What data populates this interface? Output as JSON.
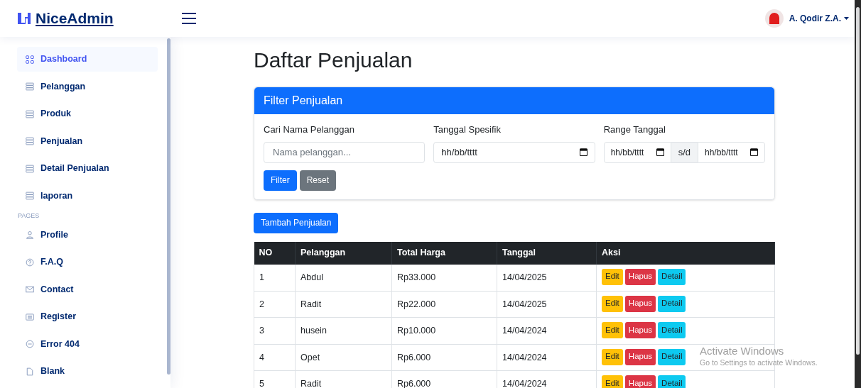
{
  "header": {
    "logo": "NiceAdmin",
    "user": "A. Qodir Z.A."
  },
  "sidebar": {
    "items": [
      {
        "label": "Dashboard",
        "selected": true
      },
      {
        "label": "Pelanggan",
        "selected": false
      },
      {
        "label": "Produk",
        "selected": false
      },
      {
        "label": "Penjualan",
        "selected": false
      },
      {
        "label": "Detail Penjualan",
        "selected": false
      },
      {
        "label": "laporan",
        "selected": false
      },
      {
        "kind": "heading",
        "label": "PAGES"
      },
      {
        "label": "Profile",
        "selected": false
      },
      {
        "label": "F.A.Q",
        "selected": false
      },
      {
        "label": "Contact",
        "selected": false
      },
      {
        "label": "Register",
        "selected": false
      },
      {
        "label": "Error 404",
        "selected": false
      },
      {
        "label": "Blank",
        "selected": false
      }
    ]
  },
  "page_title": "Daftar Penjualan",
  "filter": {
    "title": "Filter Penjualan",
    "name_label": "Cari Nama Pelanggan",
    "name_placeholder": "Nama pelanggan...",
    "date_label": "Tanggal Spesifik",
    "date_value": "hh/bb/tttt",
    "range_label": "Range Tanggal",
    "range_from": "hh/bb/tttt",
    "range_sep": "s/d",
    "range_to": "hh/bb/tttt",
    "buttons": [
      "Filter",
      "Reset"
    ]
  },
  "add_button": "Tambah Penjualan",
  "table": {
    "columns": [
      "NO",
      "Pelanggan",
      "Total Harga",
      "Tanggal",
      "Aksi"
    ],
    "rows": [
      {
        "cells": [
          "1",
          "Abdul",
          "Rp33.000",
          "14/04/2025"
        ],
        "actions": [
          "Edit",
          "Hapus",
          "Detail"
        ]
      },
      {
        "cells": [
          "2",
          "Radit",
          "Rp22.000",
          "14/04/2025"
        ],
        "actions": [
          "Edit",
          "Hapus",
          "Detail"
        ]
      },
      {
        "cells": [
          "3",
          "husein",
          "Rp10.000",
          "14/04/2024"
        ],
        "actions": [
          "Edit",
          "Hapus",
          "Detail"
        ]
      },
      {
        "cells": [
          "4",
          "Opet",
          "Rp6.000",
          "14/04/2024"
        ],
        "actions": [
          "Edit",
          "Hapus",
          "Detail"
        ]
      },
      {
        "cells": [
          "5",
          "Radit",
          "Rp6.000",
          "14/04/2024"
        ],
        "actions": [
          "Edit",
          "Hapus",
          "Detail"
        ]
      }
    ]
  },
  "os_notice": {
    "title": "Activate Windows",
    "text": "Go to Settings to activate Windows."
  }
}
